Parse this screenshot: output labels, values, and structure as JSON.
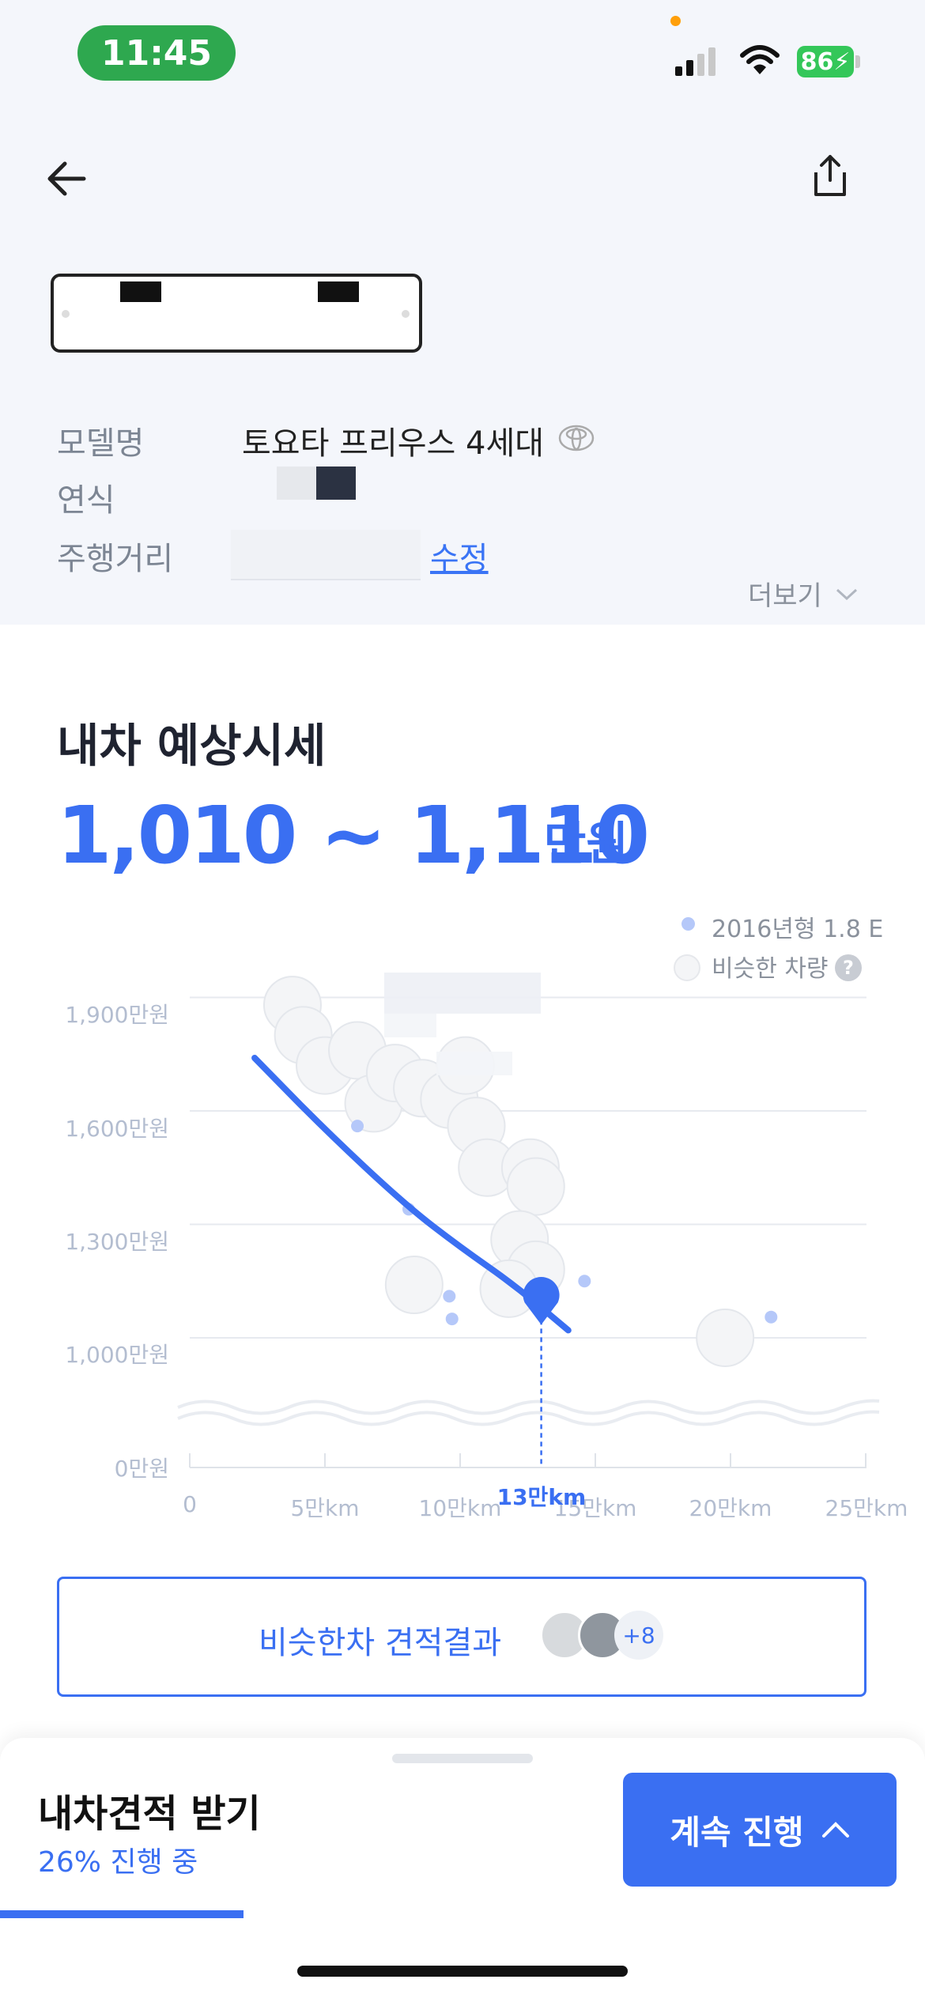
{
  "status_bar": {
    "time": "11:45",
    "battery": "86"
  },
  "car_info": {
    "model_label": "모델명",
    "model_value": "토요타 프리우스 4세대",
    "year_label": "연식",
    "mileage_label": "주행거리",
    "edit_label": "수정",
    "more_label": "더보기"
  },
  "estimate": {
    "title": "내차 예상시세",
    "range": "1,010 ~ 1,110",
    "unit": "만원"
  },
  "chart_data": {
    "type": "scatter",
    "xlabel": "",
    "ylabel": "",
    "x_ticks": [
      "0",
      "5만km",
      "10만km",
      "15만km",
      "20만km",
      "25만km"
    ],
    "y_ticks": [
      "0만원",
      "1,000만원",
      "1,300만원",
      "1,600만원",
      "1,900만원"
    ],
    "xlim": [
      0,
      25
    ],
    "ylim_visible": [
      1000,
      1900
    ],
    "legend": [
      "2016년형 1.8 E",
      "비슷한 차량"
    ],
    "marker_label": "13만km",
    "marker": {
      "x": 13,
      "y": 1110
    },
    "series": [
      {
        "name": "2016년형 1.8 E",
        "points": [
          [
            6.2,
            1560
          ],
          [
            8.1,
            1340
          ],
          [
            9.6,
            1110
          ],
          [
            9.7,
            1050
          ],
          [
            14.6,
            1150
          ],
          [
            21.5,
            1055
          ]
        ]
      },
      {
        "name": "비슷한 차량",
        "points": [
          [
            3.8,
            1880
          ],
          [
            4.2,
            1800
          ],
          [
            5.0,
            1720
          ],
          [
            6.2,
            1760
          ],
          [
            6.8,
            1620
          ],
          [
            7.6,
            1700
          ],
          [
            8.6,
            1660
          ],
          [
            9.6,
            1630
          ],
          [
            10.2,
            1720
          ],
          [
            10.6,
            1560
          ],
          [
            11.0,
            1450
          ],
          [
            12.6,
            1450
          ],
          [
            12.8,
            1400
          ],
          [
            12.2,
            1260
          ],
          [
            12.8,
            1180
          ],
          [
            8.3,
            1140
          ],
          [
            11.8,
            1130
          ],
          [
            19.8,
            1000
          ]
        ]
      }
    ],
    "trend": [
      [
        2.4,
        1740
      ],
      [
        5,
        1550
      ],
      [
        8,
        1350
      ],
      [
        10,
        1240
      ],
      [
        12,
        1140
      ],
      [
        14,
        1020
      ]
    ]
  },
  "similar": {
    "label": "비슷한차 견적결과",
    "count": "+8"
  },
  "sheet": {
    "title": "내차견적 받기",
    "progress_text": "26% 진행 중",
    "progress": 0.26,
    "continue_label": "계속 진행"
  }
}
